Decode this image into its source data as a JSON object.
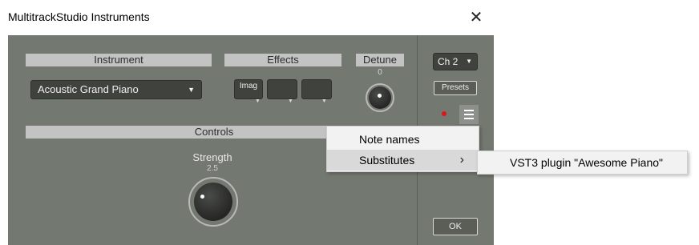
{
  "window": {
    "title": "MultitrackStudio Instruments",
    "close_glyph": "✕"
  },
  "panel": {
    "instrument_header": "Instrument",
    "effects_header": "Effects",
    "detune_header": "Detune",
    "detune_value": "0",
    "controls_header": "Controls",
    "instrument_value": "Acoustic Grand Piano",
    "effect_slot_1": "Imag",
    "strength_label": "Strength",
    "strength_value": "2.5"
  },
  "sidebar": {
    "channel_value": "Ch 2",
    "presets_label": "Presets",
    "ok_label": "OK"
  },
  "context_menu": {
    "items": [
      {
        "label": "Note names"
      },
      {
        "label": "Substitutes",
        "arrow": "›"
      }
    ]
  },
  "submenu": {
    "items": [
      {
        "label": "VST3 plugin \"Awesome Piano\""
      }
    ]
  },
  "colors": {
    "panel_bg": "#737870",
    "header_bg": "#c3c3c3",
    "record_dot": "#e01515"
  },
  "icons": [
    "close-icon",
    "caret-down-icon",
    "menu-icon",
    "record-indicator-icon",
    "chevron-right-icon"
  ]
}
